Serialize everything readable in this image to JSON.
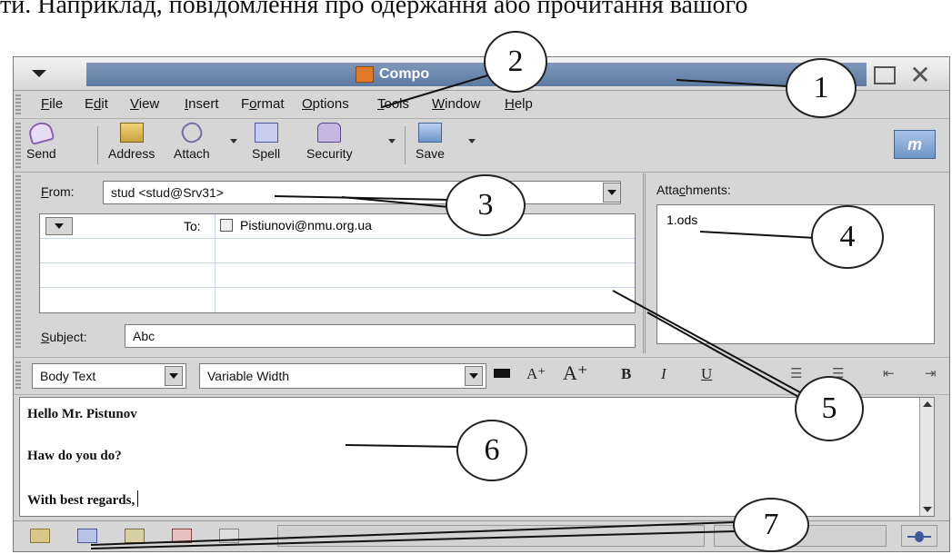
{
  "doc_text": "ти. Наприклад, повідомлення про одержання або прочитання вашого",
  "window": {
    "title": "Compo"
  },
  "menu": [
    {
      "pre": "",
      "key": "F",
      "post": "ile"
    },
    {
      "pre": "E",
      "key": "d",
      "post": "it"
    },
    {
      "pre": "",
      "key": "V",
      "post": "iew"
    },
    {
      "pre": "",
      "key": "I",
      "post": "nsert"
    },
    {
      "pre": "F",
      "key": "o",
      "post": "rmat"
    },
    {
      "pre": "",
      "key": "O",
      "post": "ptions"
    },
    {
      "pre": "",
      "key": "T",
      "post": "ools"
    },
    {
      "pre": "",
      "key": "W",
      "post": "indow"
    },
    {
      "pre": "",
      "key": "H",
      "post": "elp"
    }
  ],
  "toolbar": {
    "send": "Send",
    "address": "Address",
    "attach": "Attach",
    "spell": "Spell",
    "security": "Security",
    "save": "Save",
    "logo": "m"
  },
  "compose": {
    "from_label": "From:",
    "from_value": "stud <stud@Srv31>",
    "to_label": "To:",
    "to_value": "Pistiunovi@nmu.org.ua",
    "subject_label": "Subject:",
    "subject_value": "Abc"
  },
  "attachments": {
    "label": "Attachments:",
    "items": [
      "1.ods"
    ]
  },
  "format": {
    "paragraph_style": "Body Text",
    "font": "Variable Width"
  },
  "body": {
    "lines": [
      "Hello Mr. Pistunov",
      "Haw do you do?",
      "With best regards,"
    ]
  },
  "callouts": [
    "1",
    "2",
    "3",
    "4",
    "5",
    "6",
    "7"
  ],
  "colors": {
    "title_gradient_top": "#7f98ba",
    "title_gradient_bottom": "#5d7aa1",
    "window_bg": "#d6d6d6"
  }
}
